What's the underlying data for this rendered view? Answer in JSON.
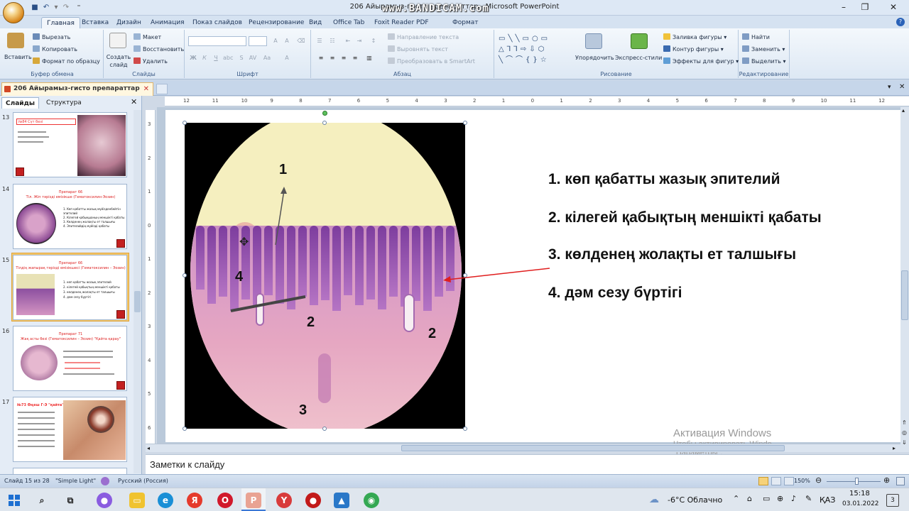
{
  "window": {
    "title": "206 Айырамыз-гисто препараттар - Microsoft PowerPoint",
    "watermark": "www.BANDICAM.com",
    "context_tab_group": "Формат"
  },
  "ribbon_tabs": [
    "Главная",
    "Вставка",
    "Дизайн",
    "Анимация",
    "Показ слайдов",
    "Рецензирование",
    "Вид",
    "Office Tab",
    "Foxit Reader PDF",
    "Формат"
  ],
  "ribbon": {
    "clipboard": {
      "paste": "Вставить",
      "cut": "Вырезать",
      "copy": "Копировать",
      "format_painter": "Формат по образцу",
      "group": "Буфер обмена"
    },
    "slides": {
      "new_slide": "Создать слайд",
      "layout": "Макет",
      "reset": "Восстановить",
      "delete": "Удалить",
      "group": "Слайды"
    },
    "font": {
      "group": "Шрифт"
    },
    "paragraph": {
      "text_direction": "Направление текста",
      "align_text": "Выровнять текст",
      "smartart": "Преобразовать в SmartArt",
      "group": "Абзац"
    },
    "drawing": {
      "arrange": "Упорядочить",
      "quick_styles": "Экспресс-стили",
      "fill": "Заливка фигуры",
      "outline": "Контур фигуры",
      "effects": "Эффекты для фигур",
      "group": "Рисование"
    },
    "editing": {
      "find": "Найти",
      "replace": "Заменить",
      "select": "Выделить",
      "group": "Редактирование"
    }
  },
  "document_tab": "206 Айырамыз-гисто препараттар",
  "panel": {
    "tabs": [
      "Слайды",
      "Структура"
    ],
    "thumbnails": [
      {
        "num": "13",
        "title": "№84 Сүт безі"
      },
      {
        "num": "14",
        "title": "Препарат 66",
        "subtitle": "Тіл. Жіп тәрізді емізікше (Гематоксилин-Эозин)",
        "items": [
          "1. Көп қабатты жазық мүйізденбейтін эпителий",
          "2. Кілегей қабықшаның меншікті қабаты",
          "3. Көлденең жолақты ет талшығы",
          "4. Эпителийдің мүйізді қабаты"
        ]
      },
      {
        "num": "15",
        "title": "Препарат 66",
        "subtitle": "Тілдің жапырақ тәрізді емізікшесі (Гематоксилин – Эозин)",
        "items": [
          "1. көп қабатты жазық эпителий",
          "2. кілегей қабықтың меншікті қабаты",
          "3. көлденең жолақты ет талшығы",
          "4. дәм сезу бүртігі"
        ]
      },
      {
        "num": "16",
        "title": "Препарат 71",
        "subtitle": "Жақ асты безі (Гематоксилин – Эозин) \"Қайта қарау\""
      },
      {
        "num": "17",
        "title": "№73 Өңеш Г-Э \"қайта\""
      }
    ]
  },
  "slide": {
    "labels": [
      "1",
      "4",
      "2",
      "2",
      "3"
    ],
    "items": [
      "1. көп қабатты жазық эпителий",
      "2. кілегей қабықтың меншікті қабаты",
      "3. көлденең жолақты ет талшығы",
      "4. дәм сезу бүртігі"
    ]
  },
  "ruler_h": [
    "12",
    "11",
    "10",
    "9",
    "8",
    "7",
    "6",
    "5",
    "4",
    "3",
    "2",
    "1",
    "0",
    "1",
    "2",
    "3",
    "4",
    "5",
    "6",
    "7",
    "8",
    "9",
    "10",
    "11",
    "12"
  ],
  "ruler_v": [
    "3",
    "2",
    "1",
    "0",
    "1",
    "2",
    "3",
    "4",
    "5",
    "6"
  ],
  "activation": {
    "line1": "Активация Windows",
    "line2": "Чтобы активировать Windo",
    "line3": "\"Параметры\"."
  },
  "notes": {
    "placeholder": "Заметки к слайду"
  },
  "status": {
    "slide": "Слайд 15 из 28",
    "theme": "\"Simple Light\"",
    "language": "Русский (Россия)",
    "zoom": "150%"
  },
  "taskbar": {
    "weather": "-6°C Облачно",
    "lang": "ҚАЗ",
    "time": "15:18",
    "date": "03.01.2022",
    "notif": "3"
  },
  "colors": {
    "accent_red": "#e01e1e",
    "ribbon_blue": "#dde8f4"
  }
}
